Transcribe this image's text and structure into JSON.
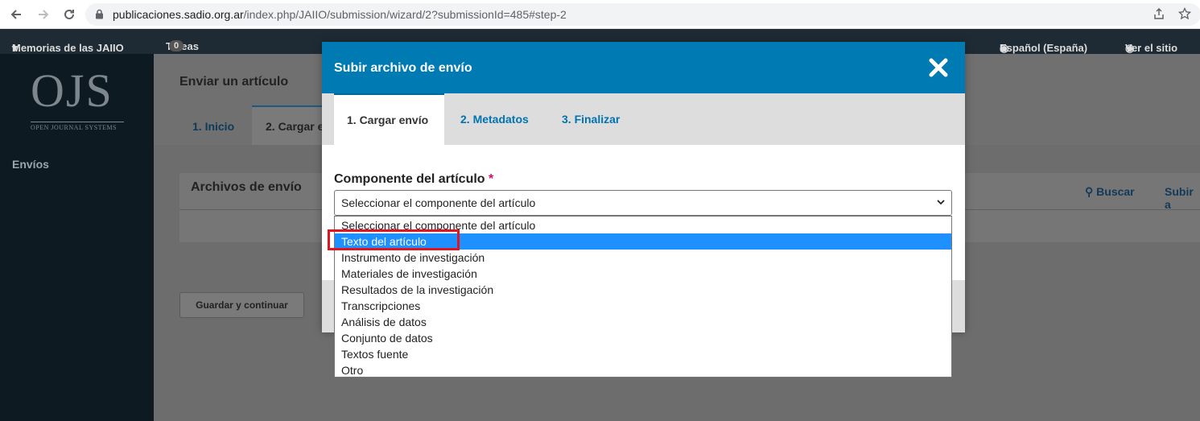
{
  "browser": {
    "url_host": "publicaciones.sadio.org.ar",
    "url_path": "/index.php/JAIIO/submission/wizard/2?submissionId=485#step-2"
  },
  "ojs_header": {
    "journal": "Memorias de las JAIIO",
    "tasks_label": "Tareas",
    "tasks_count": "0",
    "language": "Español (España)",
    "view_site": "Ver el sitio"
  },
  "sidebar": {
    "logo_big": "OJS",
    "logo_small": "OPEN JOURNAL SYSTEMS",
    "items": [
      {
        "label": "Envíos"
      }
    ]
  },
  "main": {
    "title": "Enviar un artículo",
    "tabs": [
      {
        "label": "1. Inicio"
      },
      {
        "label": "2. Cargar e"
      }
    ],
    "panel_title": "Archivos de envío",
    "search_link": "Buscar",
    "upload_link": "Subir a",
    "save_button": "Guardar y continuar"
  },
  "modal": {
    "title": "Subir archivo de envío",
    "tabs": [
      {
        "label": "1. Cargar envío",
        "active": true
      },
      {
        "label": "2. Metadatos",
        "active": false
      },
      {
        "label": "3. Finalizar",
        "active": false
      }
    ],
    "field_label": "Componente del artículo",
    "required_mark": "*",
    "select_value": "Seleccionar el componente del artículo",
    "options": [
      {
        "label": "Seleccionar el componente del artículo",
        "selected": false
      },
      {
        "label": "Texto del artículo",
        "selected": true
      },
      {
        "label": "Instrumento de investigación",
        "selected": false
      },
      {
        "label": "Materiales de investigación",
        "selected": false
      },
      {
        "label": "Resultados de la investigación",
        "selected": false
      },
      {
        "label": "Transcripciones",
        "selected": false
      },
      {
        "label": "Análisis de datos",
        "selected": false
      },
      {
        "label": "Conjunto de datos",
        "selected": false
      },
      {
        "label": "Textos fuente",
        "selected": false
      },
      {
        "label": "Otro",
        "selected": false
      }
    ]
  },
  "colors": {
    "modal_header": "#007ab2",
    "selected_option": "#1e90ff",
    "highlight_box": "#e0151f",
    "required": "#d00a6c"
  }
}
